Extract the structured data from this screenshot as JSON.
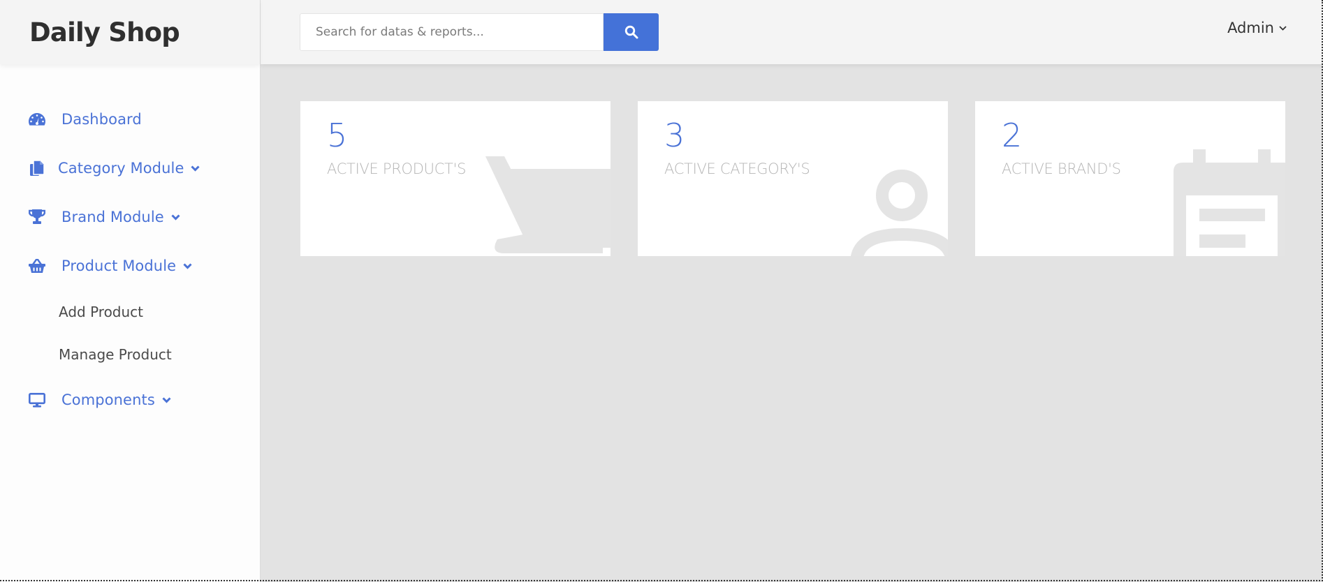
{
  "brand": {
    "title": "Daily Shop"
  },
  "header": {
    "search": {
      "placeholder": "Search for datas & reports...",
      "value": "",
      "button_icon": "search-icon"
    },
    "user_menu": {
      "label": "Admin",
      "icon": "chevron-down-icon"
    }
  },
  "sidebar": {
    "items": [
      {
        "label": "Dashboard",
        "icon": "dashboard-gauge-icon",
        "has_submenu": false
      },
      {
        "label": "Category Module",
        "icon": "copy-files-icon",
        "has_submenu": true
      },
      {
        "label": "Brand Module",
        "icon": "trophy-icon",
        "has_submenu": true
      },
      {
        "label": "Product Module",
        "icon": "shopping-basket-icon",
        "has_submenu": true,
        "expanded": true,
        "submenu": [
          {
            "label": "Add Product"
          },
          {
            "label": "Manage Product"
          }
        ]
      },
      {
        "label": "Components",
        "icon": "desktop-monitor-icon",
        "has_submenu": true
      }
    ]
  },
  "cards": [
    {
      "value": "5",
      "label": "ACTIVE PRODUCT'S",
      "icon": "shopping-cart-icon"
    },
    {
      "value": "3",
      "label": "ACTIVE CATEGORY'S",
      "icon": "person-icon"
    },
    {
      "value": "2",
      "label": "ACTIVE BRAND'S",
      "icon": "calendar-icon"
    }
  ],
  "colors": {
    "accent": "#4472d8",
    "nav_text": "#4a72d6",
    "header_bg": "#f4f4f4",
    "content_bg": "#e3e3e3",
    "card_label": "#b5b5b5",
    "card_icon": "#e4e4e4"
  }
}
